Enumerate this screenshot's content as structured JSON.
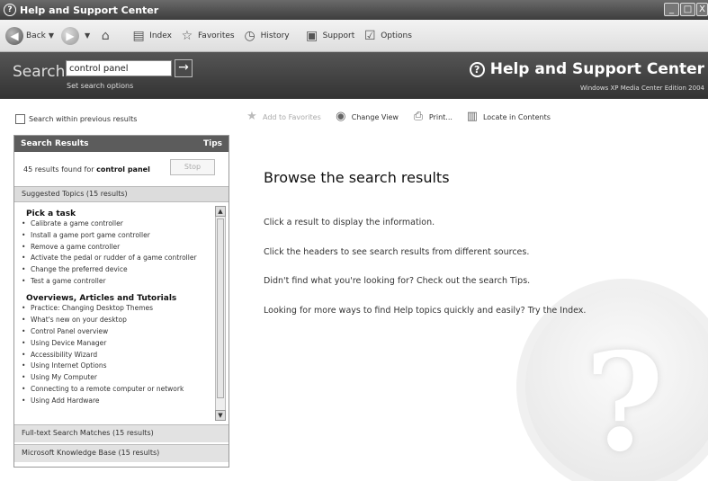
{
  "window": {
    "title": "Help and Support Center",
    "icon": "help-icon",
    "min": "_",
    "max": "□",
    "close": "X"
  },
  "toolbar": {
    "back": "Back",
    "index": "Index",
    "favorites": "Favorites",
    "history": "History",
    "support": "Support",
    "options": "Options"
  },
  "search": {
    "label": "Search",
    "value": "control panel",
    "go": "→",
    "options_link": "Set search options"
  },
  "brand": {
    "title": "Help and Support Center",
    "edition": "Windows XP Media Center Edition 2004"
  },
  "left": {
    "within_label": "Search within previous results",
    "header_title": "Search Results",
    "header_tips": "Tips",
    "count_prefix": "45 results found for",
    "count_query": "control panel",
    "stop": "Stop",
    "suggested": "Suggested Topics (15 results)",
    "sections": [
      {
        "heading": "Pick a task",
        "items": [
          "Calibrate a game controller",
          "Install a game port game controller",
          "Remove a game controller",
          "Activate the pedal or rudder of a game controller",
          "Change the preferred device",
          "Test a game controller"
        ]
      },
      {
        "heading": "Overviews, Articles and Tutorials",
        "items": [
          "Practice: Changing Desktop Themes",
          "What's new on your desktop",
          "Control Panel overview",
          "Using Device Manager",
          "Accessibility Wizard",
          "Using Internet Options",
          "Using My Computer",
          "Connecting to a remote computer or network",
          "Using Add Hardware"
        ]
      }
    ],
    "fulltext": "Full-text Search Matches (15 results)",
    "kb": "Microsoft Knowledge Base (15 results)"
  },
  "right_toolbar": {
    "add_favorites": "Add to Favorites",
    "change_view": "Change View",
    "print": "Print...",
    "locate": "Locate in Contents"
  },
  "content": {
    "title": "Browse the search results",
    "line1": "Click a result to display the information.",
    "line2": "Click the headers to see search results from different sources.",
    "line3": "Didn't find what you're looking for? Check out the search Tips.",
    "line4": "Looking for more ways to find Help topics quickly and easily? Try the Index.",
    "watermark": "?"
  }
}
